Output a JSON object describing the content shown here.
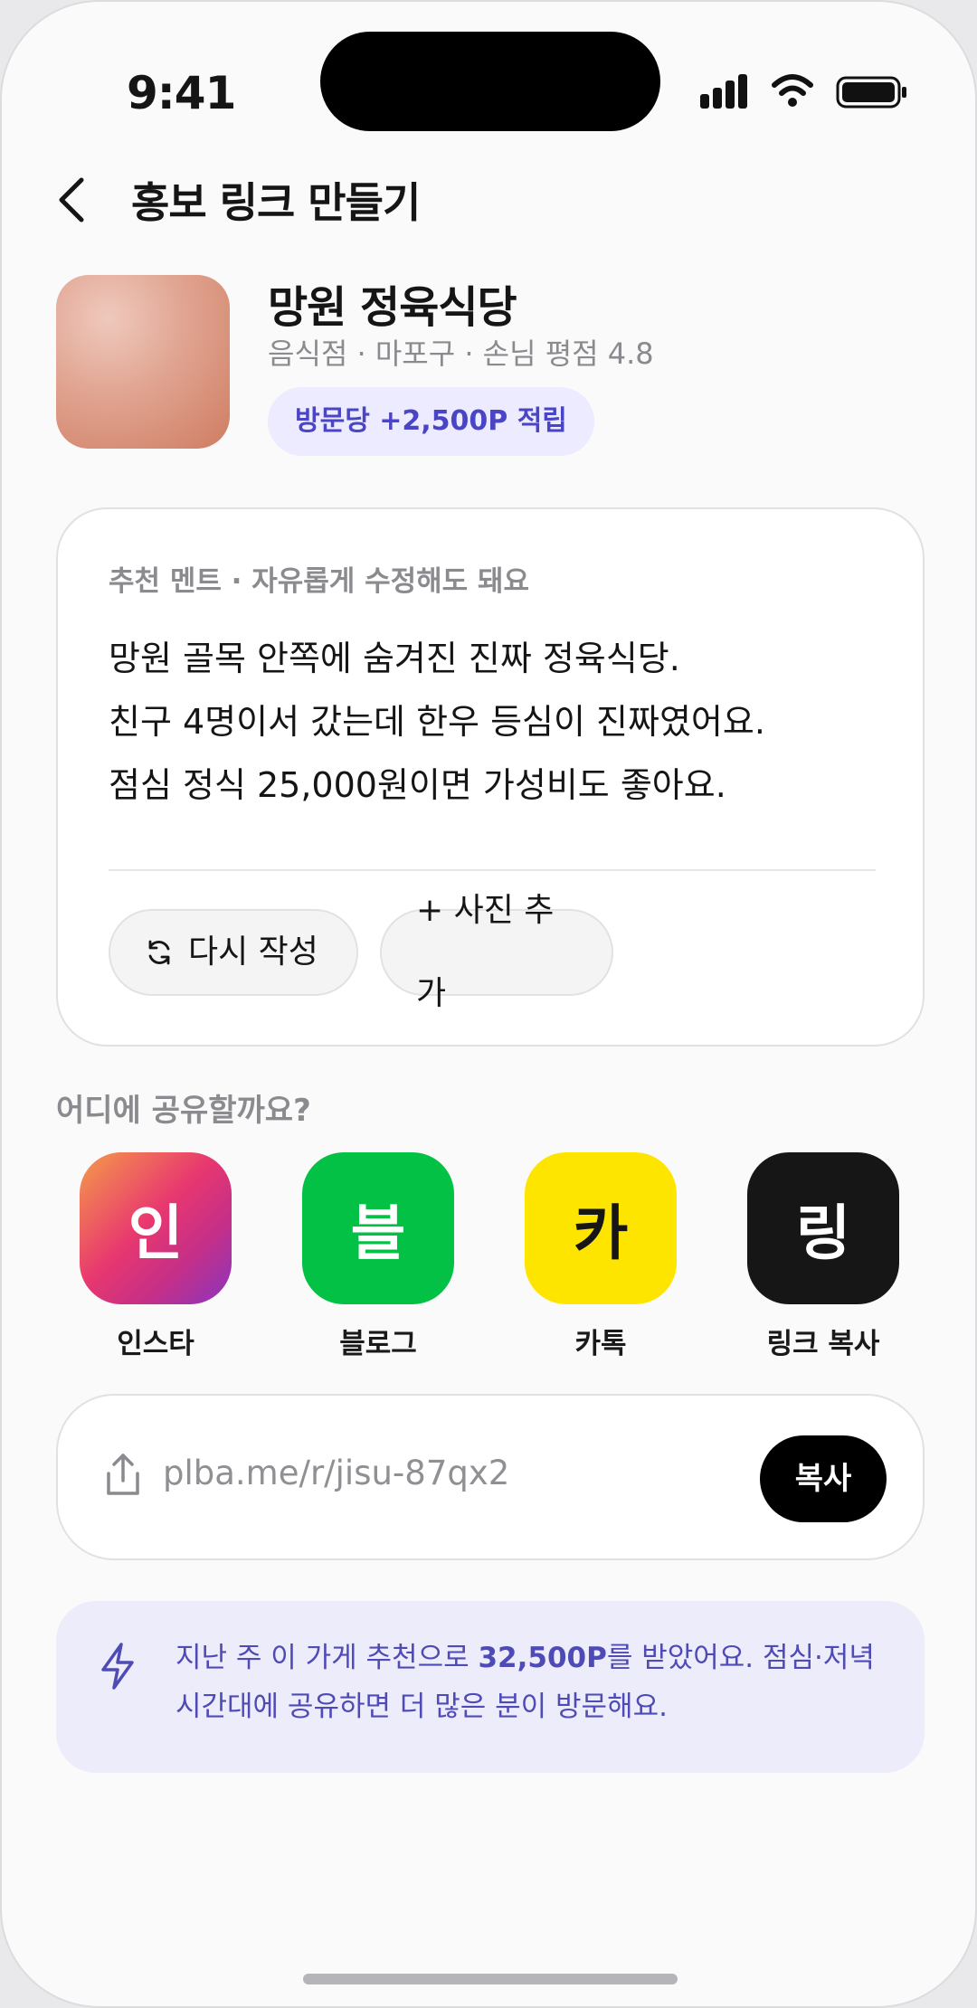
{
  "status_bar": {
    "time": "9:41"
  },
  "header": {
    "title": "홍보 링크 만들기"
  },
  "store": {
    "name": "망원 정육식당",
    "meta": "음식점 · 마포구 · 손님 평점 4.8",
    "reward_chip": "방문당 +2,500P 적립"
  },
  "recommendation": {
    "label": "추천 멘트 · 자유롭게 수정해도 돼요",
    "lines": [
      "망원 골목 안쪽에 숨겨진 진짜 정육식당.",
      "친구 4명이서 갔는데 한우 등심이 진짜였어요.",
      "점심 정식 25,000원이면 가성비도 좋아요."
    ],
    "rewrite_label": "다시 작성",
    "add_photo_label": "+ 사진 추가"
  },
  "share": {
    "title": "어디에 공유할까요?",
    "targets": [
      {
        "glyph": "인",
        "label": "인스타",
        "color": "#e8386f"
      },
      {
        "glyph": "블",
        "label": "블로그",
        "color": "#03c144"
      },
      {
        "glyph": "카",
        "label": "카톡",
        "color": "#fee500"
      },
      {
        "glyph": "링",
        "label": "링크 복사",
        "color": "#161617"
      }
    ]
  },
  "link": {
    "url": "plba.me/r/jisu-87qx2",
    "copy_label": "복사"
  },
  "tip": {
    "prefix": "지난 주 이 가게 추천으로 ",
    "highlight": "32,500P",
    "suffix": "를 받았어요. 점심·저녁 시간대에 공유하면 더 많은 분이 방문해요."
  },
  "colors": {
    "accent": "#4a45c4",
    "accent_bg": "#ecebff"
  }
}
